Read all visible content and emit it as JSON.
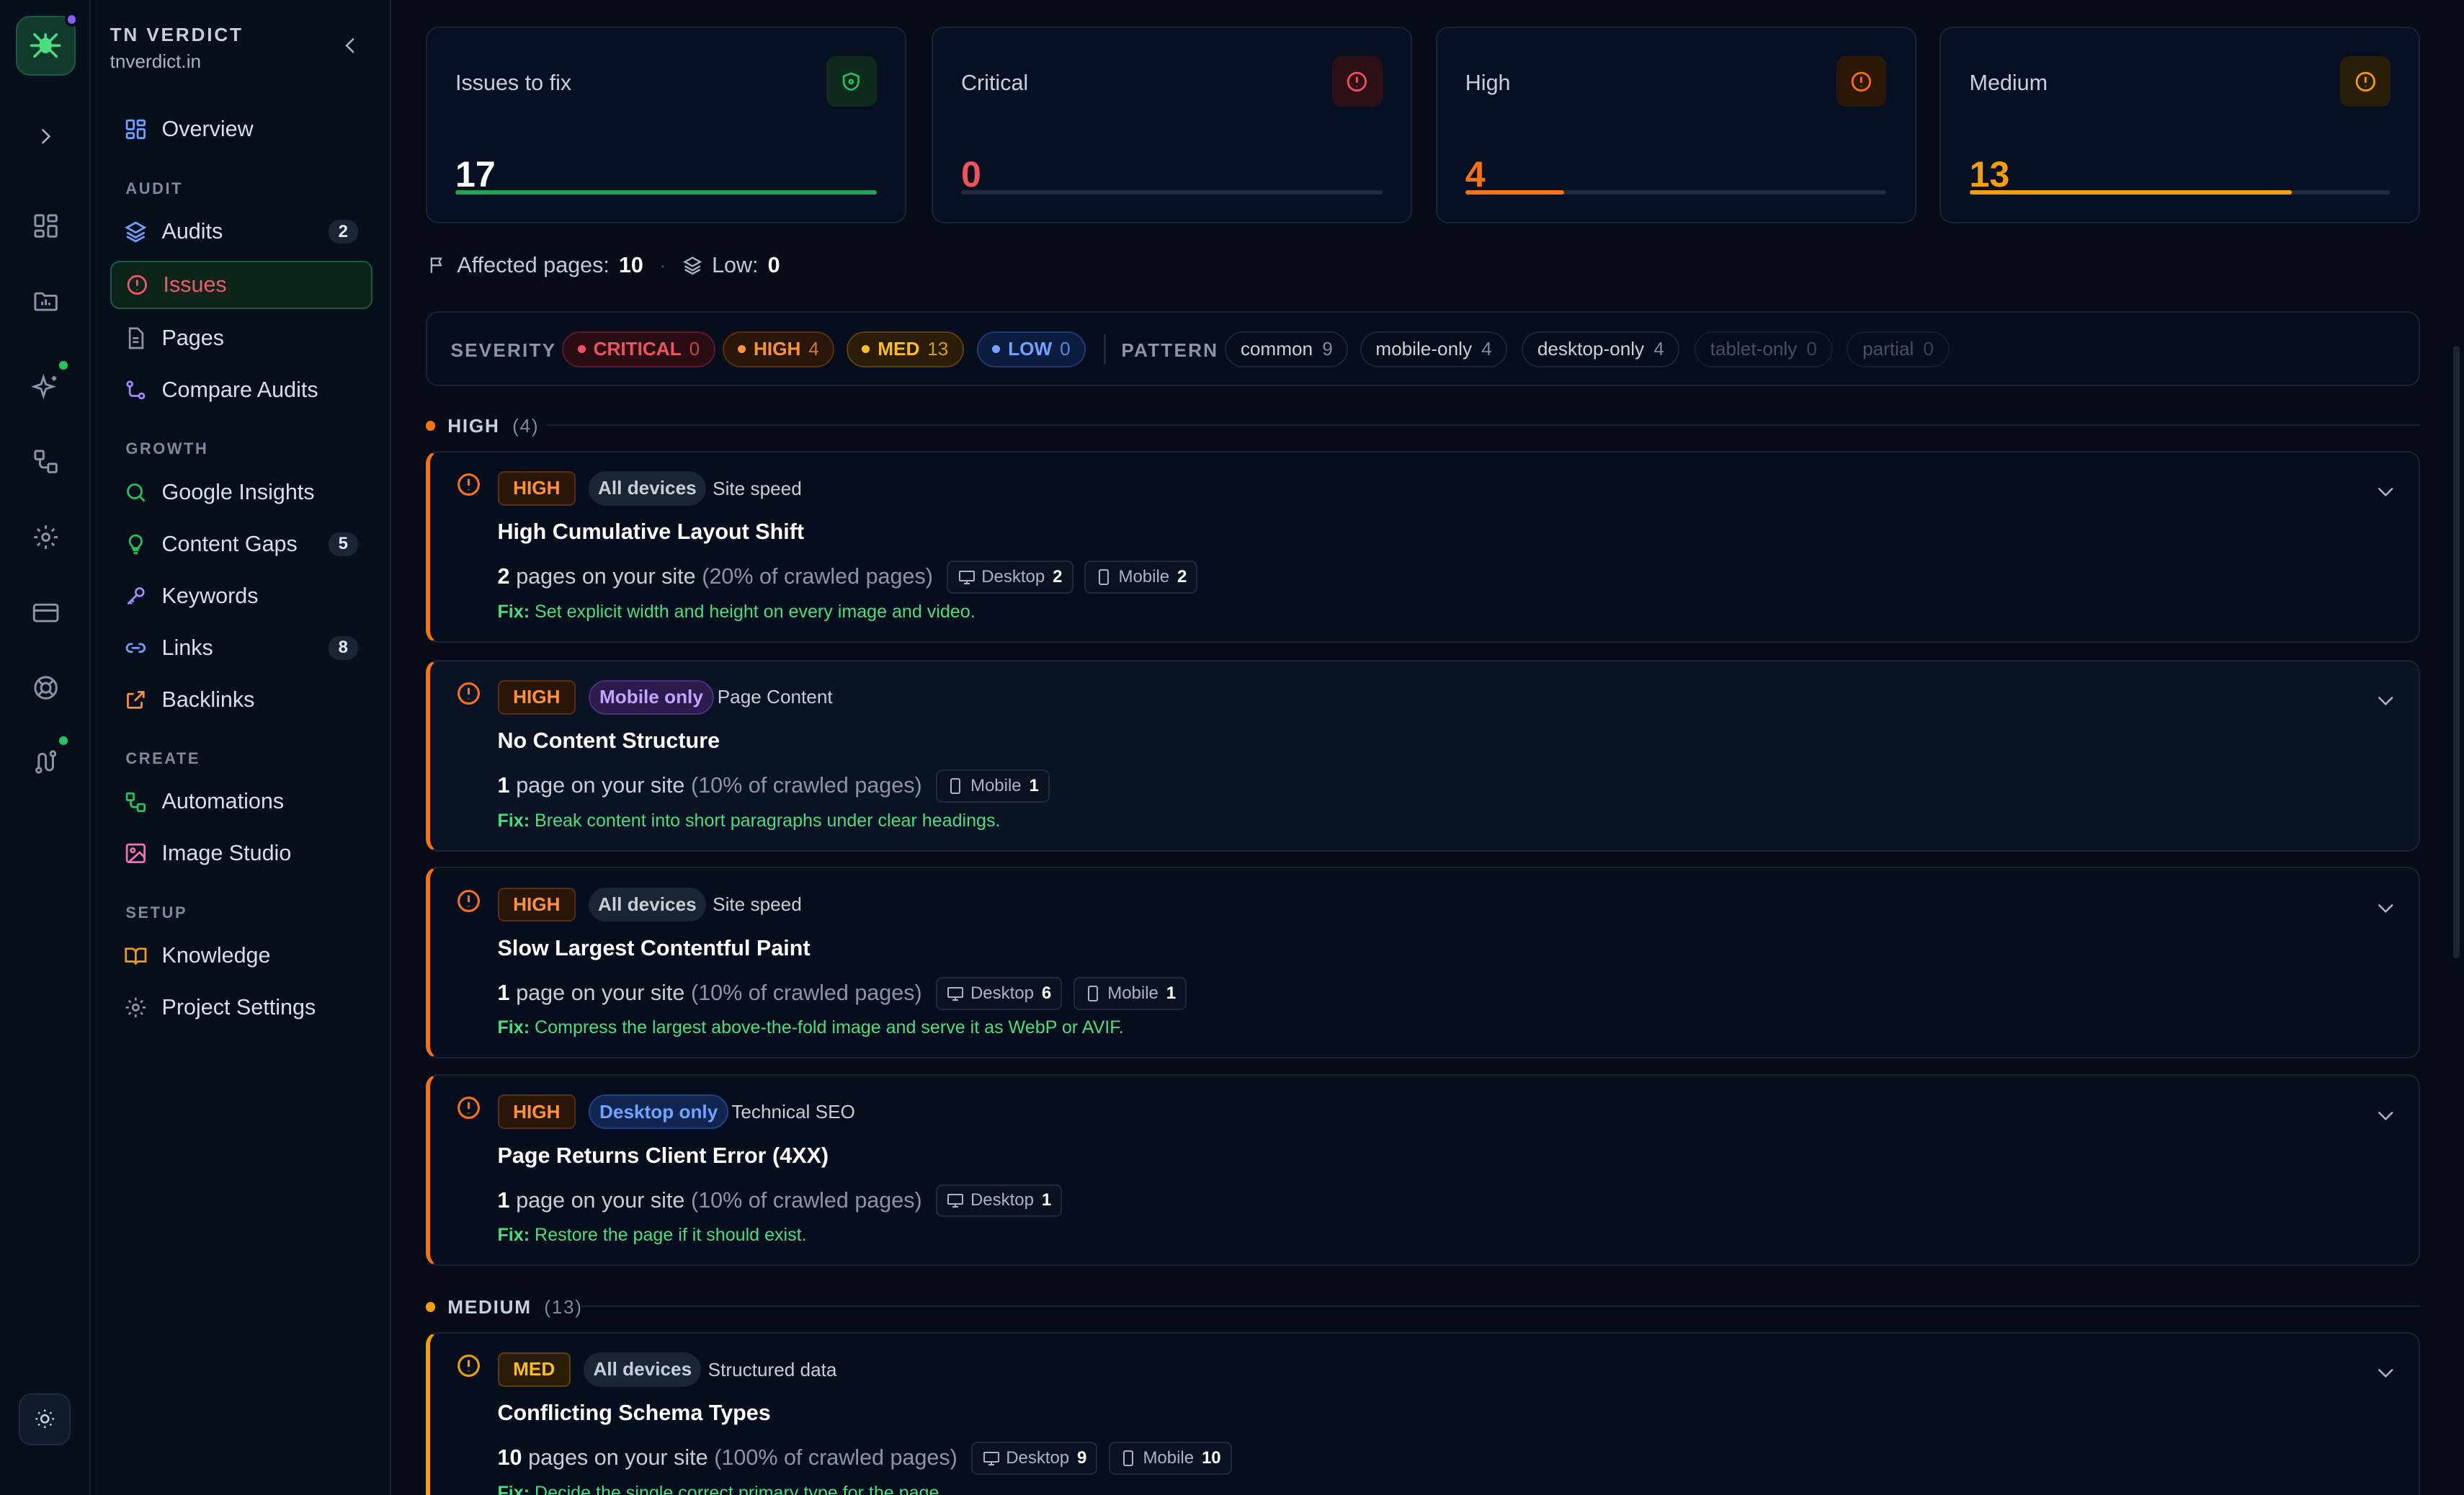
{
  "brand": {
    "name": "TN VERDICT",
    "domain": "tnverdict.in"
  },
  "nav": {
    "overview": "Overview",
    "section_audit": "AUDIT",
    "audits": "Audits",
    "audits_badge": "2",
    "issues": "Issues",
    "pages": "Pages",
    "compare": "Compare Audits",
    "section_growth": "GROWTH",
    "google_insights": "Google Insights",
    "content_gaps": "Content Gaps",
    "content_gaps_badge": "5",
    "keywords": "Keywords",
    "links": "Links",
    "links_badge": "8",
    "backlinks": "Backlinks",
    "section_create": "CREATE",
    "automations": "Automations",
    "image_studio": "Image Studio",
    "section_setup": "SETUP",
    "knowledge": "Knowledge",
    "project_settings": "Project Settings"
  },
  "cards": [
    {
      "title": "Issues to fix",
      "value": "17",
      "color": "#ffffff",
      "fill": 1.0,
      "bar": "#22a34f"
    },
    {
      "title": "Critical",
      "value": "0",
      "color": "#f0525e",
      "fill": 0.0,
      "bar": "#f0525e"
    },
    {
      "title": "High",
      "value": "4",
      "color": "#f97316",
      "fill": 0.235,
      "bar": "#f97316"
    },
    {
      "title": "Medium",
      "value": "13",
      "color": "#f59e0b",
      "fill": 0.765,
      "bar": "#f59e0b"
    }
  ],
  "meta": {
    "affected_label": "Affected pages:",
    "affected_value": "10",
    "low_label": "Low:",
    "low_value": "0"
  },
  "filters": {
    "severity_label": "SEVERITY",
    "critical": "CRITICAL",
    "critical_count": "0",
    "high": "HIGH",
    "high_count": "4",
    "med": "MED",
    "med_count": "13",
    "low": "LOW",
    "low_count": "0",
    "pattern_label": "PATTERN",
    "patterns": [
      {
        "label": "common",
        "count": "9"
      },
      {
        "label": "mobile-only",
        "count": "4"
      },
      {
        "label": "desktop-only",
        "count": "4"
      },
      {
        "label": "tablet-only",
        "count": "0"
      },
      {
        "label": "partial",
        "count": "0"
      }
    ]
  },
  "groups": {
    "high": {
      "label": "HIGH",
      "count": "(4)"
    },
    "medium": {
      "label": "MEDIUM",
      "count": "(13)"
    }
  },
  "issues": [
    {
      "severity": "HIGH",
      "devices": "All devices",
      "category": "Site speed",
      "title": "High Cumulative Layout Shift",
      "pages": "2",
      "pages_text": "pages on your site",
      "pct": "(20% of crawled pages)",
      "desktop_label": "Desktop",
      "desktop": "2",
      "mobile_label": "Mobile",
      "mobile": "2",
      "fix_label": "Fix:",
      "fix": "Set explicit width and height on every image and video."
    },
    {
      "severity": "HIGH",
      "devices": "Mobile only",
      "category": "Page Content",
      "title": "No Content Structure",
      "pages": "1",
      "pages_text": "page on your site",
      "pct": "(10% of crawled pages)",
      "mobile_label": "Mobile",
      "mobile": "1",
      "fix_label": "Fix:",
      "fix": "Break content into short paragraphs under clear headings."
    },
    {
      "severity": "HIGH",
      "devices": "All devices",
      "category": "Site speed",
      "title": "Slow Largest Contentful Paint",
      "pages": "1",
      "pages_text": "page on your site",
      "pct": "(10% of crawled pages)",
      "desktop_label": "Desktop",
      "desktop": "6",
      "mobile_label": "Mobile",
      "mobile": "1",
      "fix_label": "Fix:",
      "fix": "Compress the largest above-the-fold image and serve it as WebP or AVIF."
    },
    {
      "severity": "HIGH",
      "devices": "Desktop only",
      "category": "Technical SEO",
      "title": "Page Returns Client Error (4XX)",
      "pages": "1",
      "pages_text": "page on your site",
      "pct": "(10% of crawled pages)",
      "desktop_label": "Desktop",
      "desktop": "1",
      "fix_label": "Fix:",
      "fix": "Restore the page if it should exist."
    },
    {
      "severity": "MED",
      "devices": "All devices",
      "category": "Structured data",
      "title": "Conflicting Schema Types",
      "pages": "10",
      "pages_text": "pages on your site",
      "pct": "(100% of crawled pages)",
      "desktop_label": "Desktop",
      "desktop": "9",
      "mobile_label": "Mobile",
      "mobile": "10",
      "fix_label": "Fix:",
      "fix": "Decide the single correct primary type for the page."
    }
  ]
}
